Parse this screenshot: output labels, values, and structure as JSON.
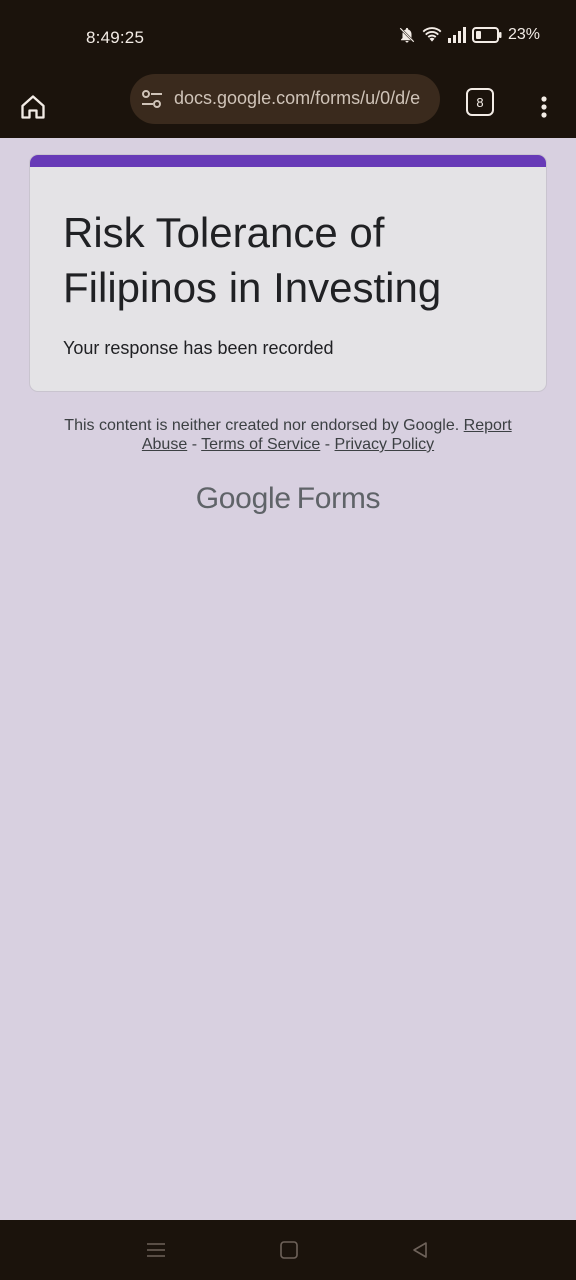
{
  "status_bar": {
    "time": "8:49:25",
    "battery_percent": "23%",
    "icons": [
      "mute-bell-icon",
      "wifi-icon",
      "signal-icon",
      "battery-icon"
    ]
  },
  "browser": {
    "url": "docs.google.com/forms/u/0/d/e",
    "tab_count": "8",
    "icons": [
      "home-icon",
      "tune-icon",
      "share-icon",
      "more-vert-icon"
    ]
  },
  "form": {
    "title": "Risk Tolerance of Filipinos in Investing",
    "message": "Your response has been recorded",
    "accent_color": "#673ab7"
  },
  "footer": {
    "disclaimer": "This content is neither created nor endorsed by Google.",
    "links": {
      "report_abuse": "Report Abuse",
      "terms": "Terms of Service",
      "privacy": "Privacy Policy"
    },
    "separator": "-",
    "brand_google": "Google",
    "brand_product": "Forms"
  },
  "nav": {
    "icons": [
      "recents-icon",
      "home-square-icon",
      "back-icon"
    ]
  }
}
